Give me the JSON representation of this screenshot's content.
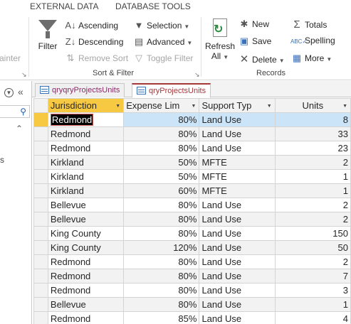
{
  "ribbon": {
    "tabs": [
      "EXTERNAL DATA",
      "DATABASE TOOLS"
    ],
    "sort_filter": {
      "filter": "Filter",
      "ascending": "Ascending",
      "descending": "Descending",
      "remove_sort": "Remove Sort",
      "selection": "Selection",
      "advanced": "Advanced",
      "toggle_filter": "Toggle Filter",
      "group_label": "Sort & Filter"
    },
    "records": {
      "refresh_line1": "Refresh",
      "refresh_line2": "All",
      "new": "New",
      "save": "Save",
      "delete": "Delete",
      "totals": "Totals",
      "spelling": "Spelling",
      "more": "More",
      "group_label": "Records"
    },
    "clipped_left_text": "ainter"
  },
  "nav_pane": {
    "collapse_glyph": "«",
    "chevron_glyph": "⌃",
    "partial_text": "s"
  },
  "doc_tabs": [
    {
      "label": "qryqryProjectsUnits",
      "active": false
    },
    {
      "label": "qryProjectsUnits",
      "active": true
    }
  ],
  "grid": {
    "columns": [
      "Jurisdiction",
      "Expense Lim",
      "Support Typ",
      "Units"
    ],
    "rows": [
      {
        "jurisdiction": "Redmond",
        "expense": "80%",
        "support": "Land Use",
        "units": "8"
      },
      {
        "jurisdiction": "Redmond",
        "expense": "80%",
        "support": "Land Use",
        "units": "33"
      },
      {
        "jurisdiction": "Redmond",
        "expense": "80%",
        "support": "Land Use",
        "units": "23"
      },
      {
        "jurisdiction": "Kirkland",
        "expense": "50%",
        "support": "MFTE",
        "units": "2"
      },
      {
        "jurisdiction": "Kirkland",
        "expense": "50%",
        "support": "MFTE",
        "units": "1"
      },
      {
        "jurisdiction": "Kirkland",
        "expense": "60%",
        "support": "MFTE",
        "units": "1"
      },
      {
        "jurisdiction": "Bellevue",
        "expense": "80%",
        "support": "Land Use",
        "units": "2"
      },
      {
        "jurisdiction": "Bellevue",
        "expense": "80%",
        "support": "Land Use",
        "units": "2"
      },
      {
        "jurisdiction": "King County",
        "expense": "80%",
        "support": "Land Use",
        "units": "150"
      },
      {
        "jurisdiction": "King County",
        "expense": "120%",
        "support": "Land Use",
        "units": "50"
      },
      {
        "jurisdiction": "Redmond",
        "expense": "80%",
        "support": "Land Use",
        "units": "2"
      },
      {
        "jurisdiction": "Redmond",
        "expense": "80%",
        "support": "Land Use",
        "units": "7"
      },
      {
        "jurisdiction": "Redmond",
        "expense": "80%",
        "support": "Land Use",
        "units": "3"
      },
      {
        "jurisdiction": "Bellevue",
        "expense": "80%",
        "support": "Land Use",
        "units": "1"
      },
      {
        "jurisdiction": "Redmond",
        "expense": "85%",
        "support": "Land Use",
        "units": "4"
      }
    ]
  },
  "colors": {
    "accent_header": "#f7c943",
    "selected_row": "#cce4f7",
    "active_tab": "#a4373a"
  }
}
